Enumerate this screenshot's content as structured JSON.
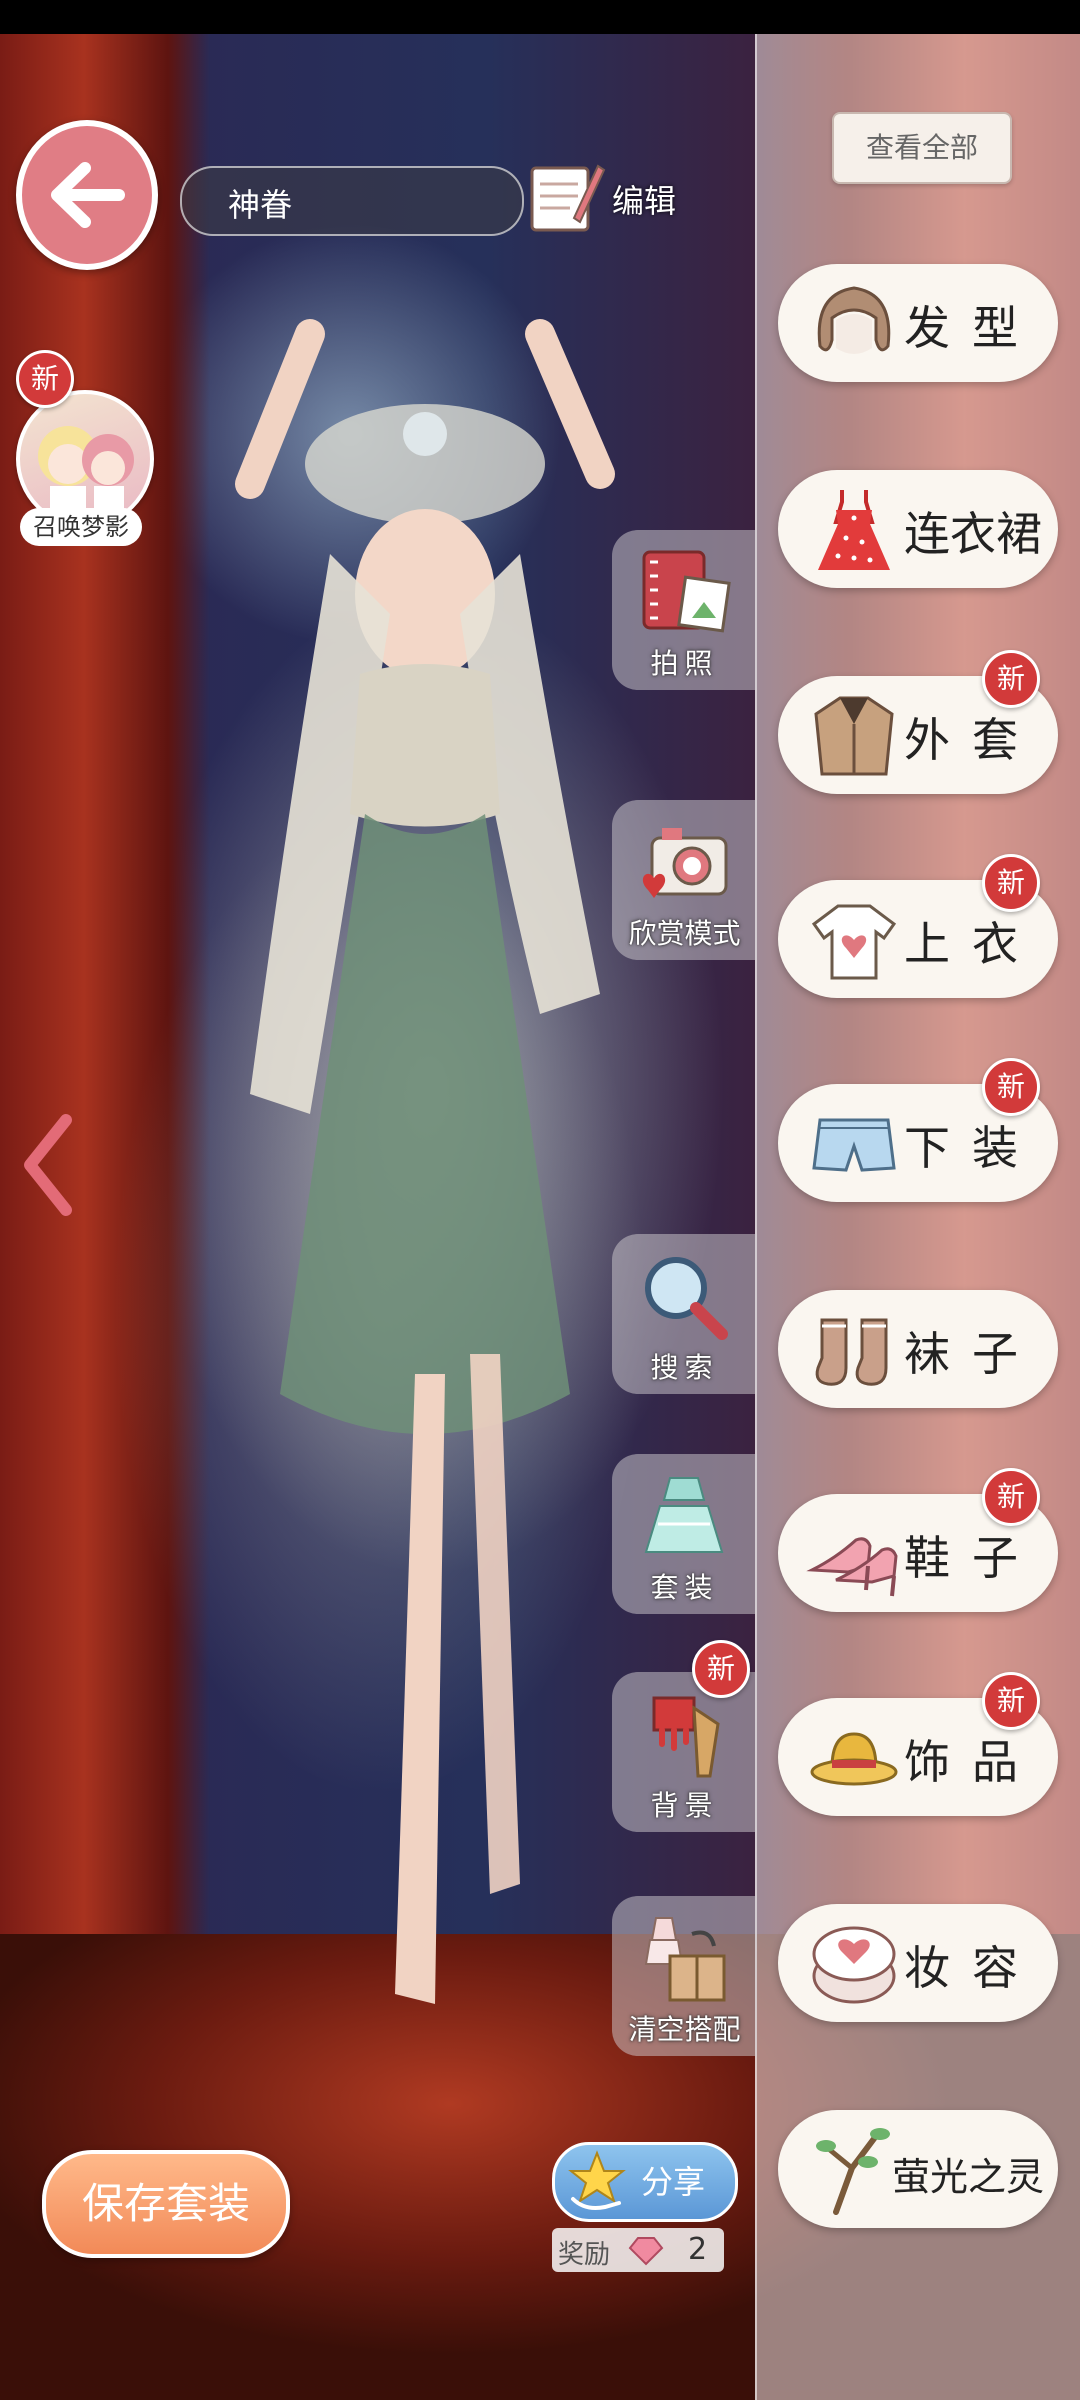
{
  "outfit": {
    "name": "神眷",
    "edit_label": "编辑"
  },
  "summon": {
    "label": "召唤梦影",
    "badge": "新"
  },
  "tools": [
    {
      "label": "拍照"
    },
    {
      "label": "欣赏模式"
    },
    {
      "label": "搜索"
    },
    {
      "label": "套装"
    },
    {
      "label": "背景",
      "badge": "新"
    },
    {
      "label": "清空搭配"
    }
  ],
  "panel": {
    "see_all": "查看全部"
  },
  "categories": [
    {
      "label": "发型",
      "icon": "hair-icon"
    },
    {
      "label": "连衣裙",
      "icon": "dress-icon"
    },
    {
      "label": "外套",
      "icon": "coat-icon",
      "badge": "新"
    },
    {
      "label": "上衣",
      "icon": "shirt-icon",
      "badge": "新"
    },
    {
      "label": "下装",
      "icon": "shorts-icon",
      "badge": "新"
    },
    {
      "label": "袜子",
      "icon": "socks-icon"
    },
    {
      "label": "鞋子",
      "icon": "shoes-icon",
      "badge": "新"
    },
    {
      "label": "饰品",
      "icon": "hat-icon",
      "badge": "新"
    },
    {
      "label": "妆容",
      "icon": "makeup-icon"
    },
    {
      "label": "萤光之灵",
      "icon": "branch-icon"
    }
  ],
  "bottom": {
    "save_label": "保存套装",
    "share_label": "分享",
    "reward_label": "奖励",
    "reward_count": "2"
  },
  "colors": {
    "accent_pink": "#e07d85",
    "badge_red": "#d23a3a",
    "save_orange": "#f28a58",
    "share_blue": "#5b97d6"
  }
}
